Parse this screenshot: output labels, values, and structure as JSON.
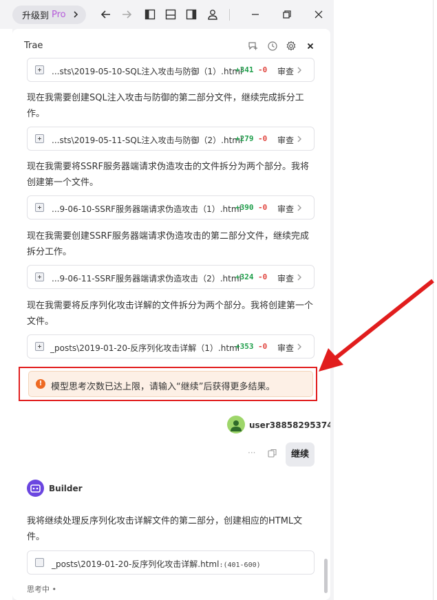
{
  "topbar": {
    "upgrade_text": "升级到",
    "upgrade_pro": "Pro"
  },
  "panel": {
    "title": "Trae"
  },
  "files": [
    {
      "name": "...sts\\2019-05-10-SQL注入攻击与防御（1）.html",
      "added": "+341",
      "removed": "-0",
      "review": "审查"
    },
    {
      "name": "...sts\\2019-05-11-SQL注入攻击与防御（2）.html",
      "added": "+279",
      "removed": "-0",
      "review": "审查"
    },
    {
      "name": "...9-06-10-SSRF服务器端请求伪造攻击（1）.html",
      "added": "+390",
      "removed": "-0",
      "review": "审查"
    },
    {
      "name": "...9-06-11-SSRF服务器端请求伪造攻击（2）.html",
      "added": "+324",
      "removed": "-0",
      "review": "审查"
    },
    {
      "name": "_posts\\2019-01-20-反序列化攻击详解（1）.html",
      "added": "+353",
      "removed": "-0",
      "review": "审查"
    }
  ],
  "paragraphs": [
    {
      "line1": "现在我需要创建SQL注入攻击与防御的第二部分文件，继续完成拆分工",
      "line2": "作。"
    },
    {
      "line1": "现在我需要将SSRF服务器端请求伪造攻击的文件拆分为两个部分。我将",
      "line2": "创建第一个文件。"
    },
    {
      "line1": "现在我需要创建SSRF服务器端请求伪造攻击的第二部分文件，继续完成",
      "line2": "拆分工作。"
    },
    {
      "line1": "现在我需要将反序列化攻击详解的文件拆分为两个部分。我将创建第一个",
      "line2": "文件。"
    }
  ],
  "alert": {
    "text": "模型思考次数已达上限，请输入“继续”后获得更多结果。"
  },
  "user": {
    "name": "user38858295374",
    "message": "继续",
    "more": "···"
  },
  "bot": {
    "name": "Builder",
    "para_line1": "我将继续处理反序列化攻击详解文件的第二部分，创建相应的HTML文",
    "para_line2": "件。",
    "read_file": "_posts\\2019-01-20-反序列化攻击详解.html",
    "read_range": ":(401-600)",
    "status": "思考中 •"
  },
  "colors": {
    "added": "#1e9e4a",
    "removed": "#e0443e",
    "alert_bg": "#fdf0e6",
    "annotation_red": "#e11d1d",
    "bot_avatar": "#6b46e0",
    "user_avatar": "#9ed66a"
  }
}
